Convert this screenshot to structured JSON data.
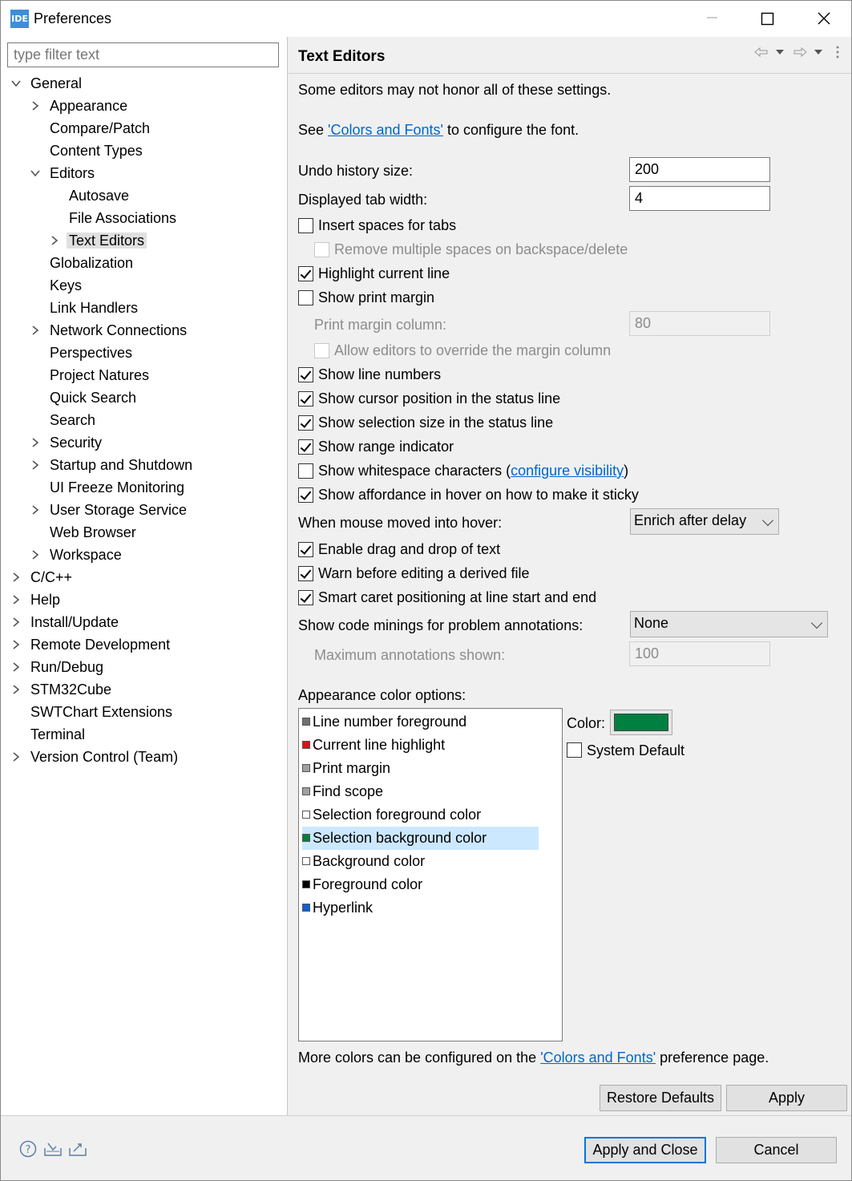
{
  "window": {
    "app_icon_text": "IDE",
    "title": "Preferences"
  },
  "filter": {
    "placeholder": "type filter text"
  },
  "tree": [
    {
      "label": "General",
      "level": 0,
      "expander": "expanded"
    },
    {
      "label": "Appearance",
      "level": 1,
      "expander": "collapsed"
    },
    {
      "label": "Compare/Patch",
      "level": 1,
      "expander": "none"
    },
    {
      "label": "Content Types",
      "level": 1,
      "expander": "none"
    },
    {
      "label": "Editors",
      "level": 1,
      "expander": "expanded"
    },
    {
      "label": "Autosave",
      "level": 2,
      "expander": "none"
    },
    {
      "label": "File Associations",
      "level": 2,
      "expander": "none"
    },
    {
      "label": "Text Editors",
      "level": 2,
      "expander": "collapsed",
      "selected": true
    },
    {
      "label": "Globalization",
      "level": 1,
      "expander": "none"
    },
    {
      "label": "Keys",
      "level": 1,
      "expander": "none"
    },
    {
      "label": "Link Handlers",
      "level": 1,
      "expander": "none"
    },
    {
      "label": "Network Connections",
      "level": 1,
      "expander": "collapsed"
    },
    {
      "label": "Perspectives",
      "level": 1,
      "expander": "none"
    },
    {
      "label": "Project Natures",
      "level": 1,
      "expander": "none"
    },
    {
      "label": "Quick Search",
      "level": 1,
      "expander": "none"
    },
    {
      "label": "Search",
      "level": 1,
      "expander": "none"
    },
    {
      "label": "Security",
      "level": 1,
      "expander": "collapsed"
    },
    {
      "label": "Startup and Shutdown",
      "level": 1,
      "expander": "collapsed"
    },
    {
      "label": "UI Freeze Monitoring",
      "level": 1,
      "expander": "none"
    },
    {
      "label": "User Storage Service",
      "level": 1,
      "expander": "collapsed"
    },
    {
      "label": "Web Browser",
      "level": 1,
      "expander": "none"
    },
    {
      "label": "Workspace",
      "level": 1,
      "expander": "collapsed"
    },
    {
      "label": "C/C++",
      "level": 0,
      "expander": "collapsed"
    },
    {
      "label": "Help",
      "level": 0,
      "expander": "collapsed"
    },
    {
      "label": "Install/Update",
      "level": 0,
      "expander": "collapsed"
    },
    {
      "label": "Remote Development",
      "level": 0,
      "expander": "collapsed"
    },
    {
      "label": "Run/Debug",
      "level": 0,
      "expander": "collapsed"
    },
    {
      "label": "STM32Cube",
      "level": 0,
      "expander": "collapsed"
    },
    {
      "label": "SWTChart Extensions",
      "level": 0,
      "expander": "none"
    },
    {
      "label": "Terminal",
      "level": 0,
      "expander": "none"
    },
    {
      "label": "Version Control (Team)",
      "level": 0,
      "expander": "collapsed"
    }
  ],
  "page": {
    "title": "Text Editors",
    "note": "Some editors may not honor all of these settings.",
    "font_line": {
      "prefix": "See ",
      "link": "'Colors and Fonts'",
      "suffix": " to configure the font."
    },
    "undo_label": "Undo history size:",
    "undo_value": "200",
    "tab_label": "Displayed tab width:",
    "tab_value": "4",
    "print_margin_column_label": "Print margin column:",
    "print_margin_column_value": "80",
    "hover_label": "When mouse moved into hover:",
    "hover_value": "Enrich after delay",
    "minings_label": "Show code minings for problem annotations:",
    "minings_value": "None",
    "max_annotations_label": "Maximum annotations shown:",
    "max_annotations_value": "100",
    "appearance_label": "Appearance color options:",
    "color_label": "Color:",
    "system_default_label": "System Default",
    "more_colors": {
      "prefix": "More colors can be configured on the ",
      "link": "'Colors and Fonts'",
      "suffix": " preference page."
    },
    "selected_color": "#008040"
  },
  "checkboxes": {
    "insert_spaces": {
      "label": "Insert spaces for tabs",
      "checked": false
    },
    "remove_spaces": {
      "label": "Remove multiple spaces on backspace/delete",
      "checked": false,
      "enabled": false
    },
    "highlight_line": {
      "label": "Highlight current line",
      "checked": true
    },
    "print_margin": {
      "label": "Show print margin",
      "checked": false
    },
    "allow_override": {
      "label": "Allow editors to override the margin column",
      "checked": false,
      "enabled": false
    },
    "line_numbers": {
      "label": "Show line numbers",
      "checked": true
    },
    "cursor_position": {
      "label": "Show cursor position in the status line",
      "checked": true
    },
    "selection_size": {
      "label": "Show selection size in the status line",
      "checked": true
    },
    "range_indicator": {
      "label": "Show range indicator",
      "checked": true
    },
    "whitespace": {
      "label": "Show whitespace characters (",
      "link": "configure visibility",
      "suffix": ")",
      "checked": false
    },
    "affordance": {
      "label": "Show affordance in hover on how to make it sticky",
      "checked": true
    },
    "drag_drop": {
      "label": "Enable drag and drop of text",
      "checked": true
    },
    "warn_derived": {
      "label": "Warn before editing a derived file",
      "checked": true
    },
    "smart_caret": {
      "label": "Smart caret positioning at line start and end",
      "checked": true
    },
    "system_default": {
      "checked": false
    }
  },
  "color_options": [
    {
      "label": "Line number foreground",
      "color": "#707070"
    },
    {
      "label": "Current line highlight",
      "color": "#e01010"
    },
    {
      "label": "Print margin",
      "color": "#a0a0a0"
    },
    {
      "label": "Find scope",
      "color": "#a0a0a0"
    },
    {
      "label": "Selection foreground color",
      "color": "#ffffff"
    },
    {
      "label": "Selection background color",
      "color": "#008040",
      "selected": true
    },
    {
      "label": "Background color",
      "color": "#ffffff"
    },
    {
      "label": "Foreground color",
      "color": "#000000"
    },
    {
      "label": "Hyperlink",
      "color": "#1060d0"
    }
  ],
  "buttons": {
    "restore_defaults": "Restore Defaults",
    "apply": "Apply",
    "apply_close": "Apply and Close",
    "cancel": "Cancel"
  },
  "icons": {
    "window_minimize": "minimize-icon",
    "window_maximize": "maximize-icon",
    "window_close": "close-icon",
    "nav_back": "back-arrow-icon",
    "nav_forward": "forward-arrow-icon",
    "view_menu": "more-vertical-icon",
    "help": "help-icon",
    "import": "import-icon",
    "export": "export-icon"
  }
}
